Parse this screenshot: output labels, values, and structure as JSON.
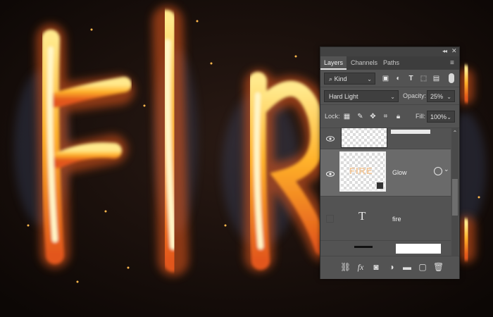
{
  "background": {
    "artwork": "burning fire text on dark background",
    "colors": {
      "fire_core": "#fff2a0",
      "fire_mid": "#ffb22a",
      "fire_edge": "#e2561b",
      "smoke": "#3b4a6b",
      "bg": "#120b09"
    }
  },
  "panel": {
    "tabs": [
      {
        "label": "Layers",
        "active": true
      },
      {
        "label": "Channels",
        "active": false
      },
      {
        "label": "Paths",
        "active": false
      }
    ],
    "filter": {
      "label": "Kind",
      "icons": [
        "image-filter-icon",
        "adjustment-filter-icon",
        "type-filter-icon",
        "shape-filter-icon",
        "smart-object-filter-icon"
      ]
    },
    "blend_mode": "Hard Light",
    "opacity": {
      "label": "Opacity:",
      "value": "25%"
    },
    "lock": {
      "label": "Lock:",
      "icons": [
        "lock-transparent-icon",
        "lock-image-icon",
        "lock-position-icon",
        "lock-artboard-icon",
        "lock-all-icon"
      ]
    },
    "fill": {
      "label": "Fill:",
      "value": "100%"
    },
    "layers": [
      {
        "name": "",
        "visible": true,
        "selected": false,
        "kind": "pixel"
      },
      {
        "name": "Glow",
        "visible": true,
        "selected": true,
        "kind": "pixel",
        "thumb_text": "FIRE"
      },
      {
        "name": "fire",
        "visible": false,
        "selected": false,
        "kind": "type"
      },
      {
        "name": "",
        "visible": false,
        "selected": false,
        "kind": "pixel"
      }
    ],
    "bottom_icons": [
      "link-icon",
      "fx-icon",
      "mask-icon",
      "adjustment-icon",
      "folder-icon",
      "new-layer-icon",
      "trash-icon"
    ],
    "fx_label": "fx"
  }
}
